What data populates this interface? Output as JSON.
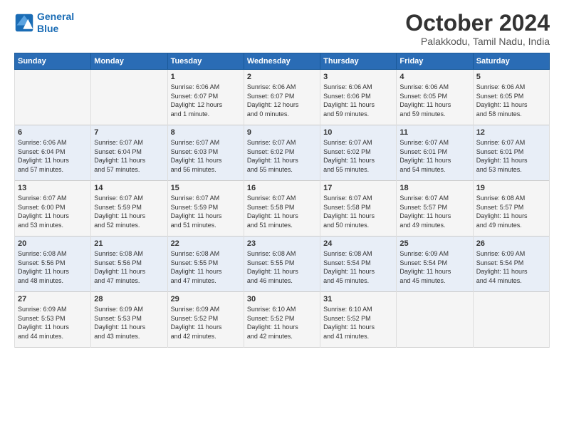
{
  "header": {
    "logo_line1": "General",
    "logo_line2": "Blue",
    "month": "October 2024",
    "location": "Palakkodu, Tamil Nadu, India"
  },
  "weekdays": [
    "Sunday",
    "Monday",
    "Tuesday",
    "Wednesday",
    "Thursday",
    "Friday",
    "Saturday"
  ],
  "weeks": [
    [
      {
        "day": "",
        "info": ""
      },
      {
        "day": "",
        "info": ""
      },
      {
        "day": "1",
        "info": "Sunrise: 6:06 AM\nSunset: 6:07 PM\nDaylight: 12 hours\nand 1 minute."
      },
      {
        "day": "2",
        "info": "Sunrise: 6:06 AM\nSunset: 6:07 PM\nDaylight: 12 hours\nand 0 minutes."
      },
      {
        "day": "3",
        "info": "Sunrise: 6:06 AM\nSunset: 6:06 PM\nDaylight: 11 hours\nand 59 minutes."
      },
      {
        "day": "4",
        "info": "Sunrise: 6:06 AM\nSunset: 6:05 PM\nDaylight: 11 hours\nand 59 minutes."
      },
      {
        "day": "5",
        "info": "Sunrise: 6:06 AM\nSunset: 6:05 PM\nDaylight: 11 hours\nand 58 minutes."
      }
    ],
    [
      {
        "day": "6",
        "info": "Sunrise: 6:06 AM\nSunset: 6:04 PM\nDaylight: 11 hours\nand 57 minutes."
      },
      {
        "day": "7",
        "info": "Sunrise: 6:07 AM\nSunset: 6:04 PM\nDaylight: 11 hours\nand 57 minutes."
      },
      {
        "day": "8",
        "info": "Sunrise: 6:07 AM\nSunset: 6:03 PM\nDaylight: 11 hours\nand 56 minutes."
      },
      {
        "day": "9",
        "info": "Sunrise: 6:07 AM\nSunset: 6:02 PM\nDaylight: 11 hours\nand 55 minutes."
      },
      {
        "day": "10",
        "info": "Sunrise: 6:07 AM\nSunset: 6:02 PM\nDaylight: 11 hours\nand 55 minutes."
      },
      {
        "day": "11",
        "info": "Sunrise: 6:07 AM\nSunset: 6:01 PM\nDaylight: 11 hours\nand 54 minutes."
      },
      {
        "day": "12",
        "info": "Sunrise: 6:07 AM\nSunset: 6:01 PM\nDaylight: 11 hours\nand 53 minutes."
      }
    ],
    [
      {
        "day": "13",
        "info": "Sunrise: 6:07 AM\nSunset: 6:00 PM\nDaylight: 11 hours\nand 53 minutes."
      },
      {
        "day": "14",
        "info": "Sunrise: 6:07 AM\nSunset: 5:59 PM\nDaylight: 11 hours\nand 52 minutes."
      },
      {
        "day": "15",
        "info": "Sunrise: 6:07 AM\nSunset: 5:59 PM\nDaylight: 11 hours\nand 51 minutes."
      },
      {
        "day": "16",
        "info": "Sunrise: 6:07 AM\nSunset: 5:58 PM\nDaylight: 11 hours\nand 51 minutes."
      },
      {
        "day": "17",
        "info": "Sunrise: 6:07 AM\nSunset: 5:58 PM\nDaylight: 11 hours\nand 50 minutes."
      },
      {
        "day": "18",
        "info": "Sunrise: 6:07 AM\nSunset: 5:57 PM\nDaylight: 11 hours\nand 49 minutes."
      },
      {
        "day": "19",
        "info": "Sunrise: 6:08 AM\nSunset: 5:57 PM\nDaylight: 11 hours\nand 49 minutes."
      }
    ],
    [
      {
        "day": "20",
        "info": "Sunrise: 6:08 AM\nSunset: 5:56 PM\nDaylight: 11 hours\nand 48 minutes."
      },
      {
        "day": "21",
        "info": "Sunrise: 6:08 AM\nSunset: 5:56 PM\nDaylight: 11 hours\nand 47 minutes."
      },
      {
        "day": "22",
        "info": "Sunrise: 6:08 AM\nSunset: 5:55 PM\nDaylight: 11 hours\nand 47 minutes."
      },
      {
        "day": "23",
        "info": "Sunrise: 6:08 AM\nSunset: 5:55 PM\nDaylight: 11 hours\nand 46 minutes."
      },
      {
        "day": "24",
        "info": "Sunrise: 6:08 AM\nSunset: 5:54 PM\nDaylight: 11 hours\nand 45 minutes."
      },
      {
        "day": "25",
        "info": "Sunrise: 6:09 AM\nSunset: 5:54 PM\nDaylight: 11 hours\nand 45 minutes."
      },
      {
        "day": "26",
        "info": "Sunrise: 6:09 AM\nSunset: 5:54 PM\nDaylight: 11 hours\nand 44 minutes."
      }
    ],
    [
      {
        "day": "27",
        "info": "Sunrise: 6:09 AM\nSunset: 5:53 PM\nDaylight: 11 hours\nand 44 minutes."
      },
      {
        "day": "28",
        "info": "Sunrise: 6:09 AM\nSunset: 5:53 PM\nDaylight: 11 hours\nand 43 minutes."
      },
      {
        "day": "29",
        "info": "Sunrise: 6:09 AM\nSunset: 5:52 PM\nDaylight: 11 hours\nand 42 minutes."
      },
      {
        "day": "30",
        "info": "Sunrise: 6:10 AM\nSunset: 5:52 PM\nDaylight: 11 hours\nand 42 minutes."
      },
      {
        "day": "31",
        "info": "Sunrise: 6:10 AM\nSunset: 5:52 PM\nDaylight: 11 hours\nand 41 minutes."
      },
      {
        "day": "",
        "info": ""
      },
      {
        "day": "",
        "info": ""
      }
    ]
  ]
}
